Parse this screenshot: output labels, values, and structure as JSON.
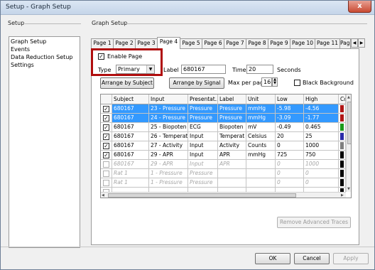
{
  "window": {
    "title": "Setup - Graph Setup",
    "close_label": "x"
  },
  "setup_group": {
    "label": "Setup"
  },
  "graph_setup_group": {
    "label": "Graph Setup"
  },
  "sidebar": {
    "items": [
      {
        "label": "Graph Setup"
      },
      {
        "label": "Events"
      },
      {
        "label": "Data Reduction Setup"
      },
      {
        "label": "Settings"
      }
    ]
  },
  "tabs": [
    {
      "label": "Page 1"
    },
    {
      "label": "Page 2"
    },
    {
      "label": "Page 3"
    },
    {
      "label": "Page 4"
    },
    {
      "label": "Page 5"
    },
    {
      "label": "Page 6"
    },
    {
      "label": "Page 7"
    },
    {
      "label": "Page 8"
    },
    {
      "label": "Page 9"
    },
    {
      "label": "Page 10"
    },
    {
      "label": "Page 11"
    },
    {
      "label": "Page"
    }
  ],
  "active_tab": "Page 4",
  "page": {
    "enable_page_label": "Enable Page",
    "enable_page_checked": true,
    "type_label": "Type",
    "type_value": "Primary",
    "label_label": "Label",
    "label_value": "680167",
    "time_label": "Time",
    "time_value": "20",
    "time_unit": "Seconds",
    "arrange_subject_label": "Arrange by Subject",
    "arrange_signal_label": "Arrange by Signal",
    "max_per_page_label": "Max per page",
    "max_per_page_value": "16",
    "black_background_label": "Black Background",
    "black_background_checked": false,
    "remove_advanced_label": "Remove Advanced Traces"
  },
  "grid": {
    "columns": [
      "Subject",
      "Input",
      "Presentat...",
      "Label",
      "Unit",
      "Low",
      "High",
      "Co"
    ],
    "rows": [
      {
        "checked": true,
        "subject": "680167",
        "input": "23 - Pressure",
        "presentation": "Pressure",
        "label": "Pressure",
        "unit": "mmHg",
        "low": "-5.98",
        "high": "-4.56",
        "color": "#b01717",
        "selected": true,
        "enabled": true
      },
      {
        "checked": true,
        "subject": "680167",
        "input": "24 - Pressure",
        "presentation": "Pressure",
        "label": "Pressure",
        "unit": "mmHg",
        "low": "-3.09",
        "high": "-1.77",
        "color": "#b01717",
        "selected": true,
        "enabled": true
      },
      {
        "checked": true,
        "subject": "680167",
        "input": "25 - Biopoten",
        "presentation": "ECG",
        "label": "Biopoten",
        "unit": "mV",
        "low": "-0.49",
        "high": "0.465",
        "color": "#1a9a1a",
        "selected": false,
        "enabled": true
      },
      {
        "checked": true,
        "subject": "680167",
        "input": "26 - Temperat",
        "presentation": "Input",
        "label": "Temperat",
        "unit": "Celsius",
        "low": "20",
        "high": "25",
        "color": "#2a2aa8",
        "selected": false,
        "enabled": true
      },
      {
        "checked": true,
        "subject": "680167",
        "input": "27 - Activity",
        "presentation": "Input",
        "label": "Activity",
        "unit": "Counts",
        "low": "0",
        "high": "1000",
        "color": "#7f7f7f",
        "selected": false,
        "enabled": true
      },
      {
        "checked": true,
        "subject": "680167",
        "input": "29 - APR",
        "presentation": "Input",
        "label": "APR",
        "unit": "mmHg",
        "low": "725",
        "high": "750",
        "color": "#000000",
        "selected": false,
        "enabled": true
      },
      {
        "checked": false,
        "subject": "680167",
        "input": "29 - APR",
        "presentation": "Input",
        "label": "APR",
        "unit": "",
        "low": "0",
        "high": "1000",
        "color": "#000000",
        "selected": false,
        "enabled": false
      },
      {
        "checked": false,
        "subject": "Rat 1",
        "input": "1 - Pressure",
        "presentation": "Pressure",
        "label": "",
        "unit": "",
        "low": "0",
        "high": "0",
        "color": "#000000",
        "selected": false,
        "enabled": false
      },
      {
        "checked": false,
        "subject": "Rat 1",
        "input": "1 - Pressure",
        "presentation": "Pressure",
        "label": "",
        "unit": "",
        "low": "0",
        "high": "0",
        "color": "#000000",
        "selected": false,
        "enabled": false
      },
      {
        "checked": false,
        "subject": "",
        "input": "",
        "presentation": "",
        "label": "",
        "unit": "",
        "low": "",
        "high": "",
        "color": "#000000",
        "selected": false,
        "enabled": false
      }
    ]
  },
  "footer": {
    "ok_label": "OK",
    "cancel_label": "Cancel",
    "apply_label": "Apply"
  }
}
